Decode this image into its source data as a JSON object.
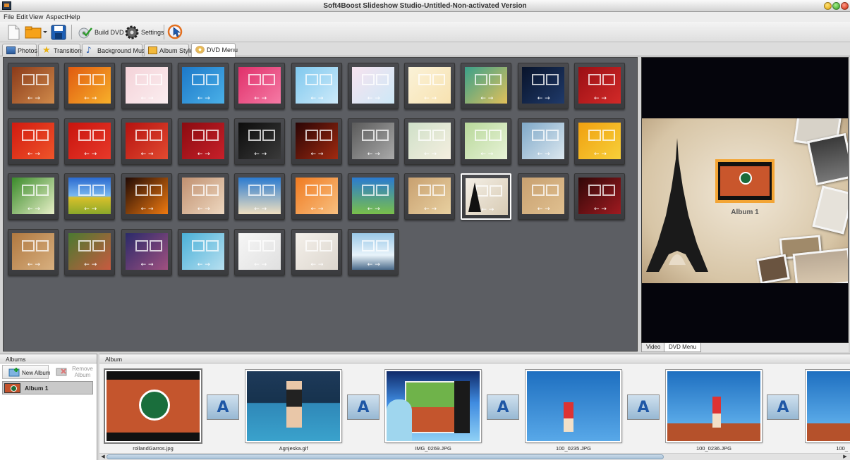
{
  "window": {
    "title": "Soft4Boost Slideshow Studio-Untitled-Non-activated Version"
  },
  "menu": [
    "File",
    "Edit",
    "View",
    "Aspect",
    "Help"
  ],
  "toolbar": {
    "build_dvd": "Build DVD",
    "settings": "Settings"
  },
  "tabs": [
    "Photos",
    "Transitions",
    "Background Music",
    "Album Style",
    "DVD Menu"
  ],
  "active_tab": "DVD Menu",
  "templates_count": 40,
  "selected_template_index": 30,
  "preview": {
    "album_label": "Album 1",
    "tabs": [
      "Video",
      "DVD Menu"
    ],
    "active_tab": "DVD Menu"
  },
  "albums_panel": {
    "header": "Albums",
    "new_album": "New Album",
    "remove_album": "Remove Album",
    "items": [
      "Album 1"
    ]
  },
  "album_panel": {
    "header": "Album",
    "photos": [
      {
        "file": "rollandGarros.jpg"
      },
      {
        "file": "Agnjeska.gif"
      },
      {
        "file": "IMG_0269.JPG"
      },
      {
        "file": "100_0235.JPG"
      },
      {
        "file": "100_0236.JPG"
      },
      {
        "file": "100_"
      }
    ]
  }
}
